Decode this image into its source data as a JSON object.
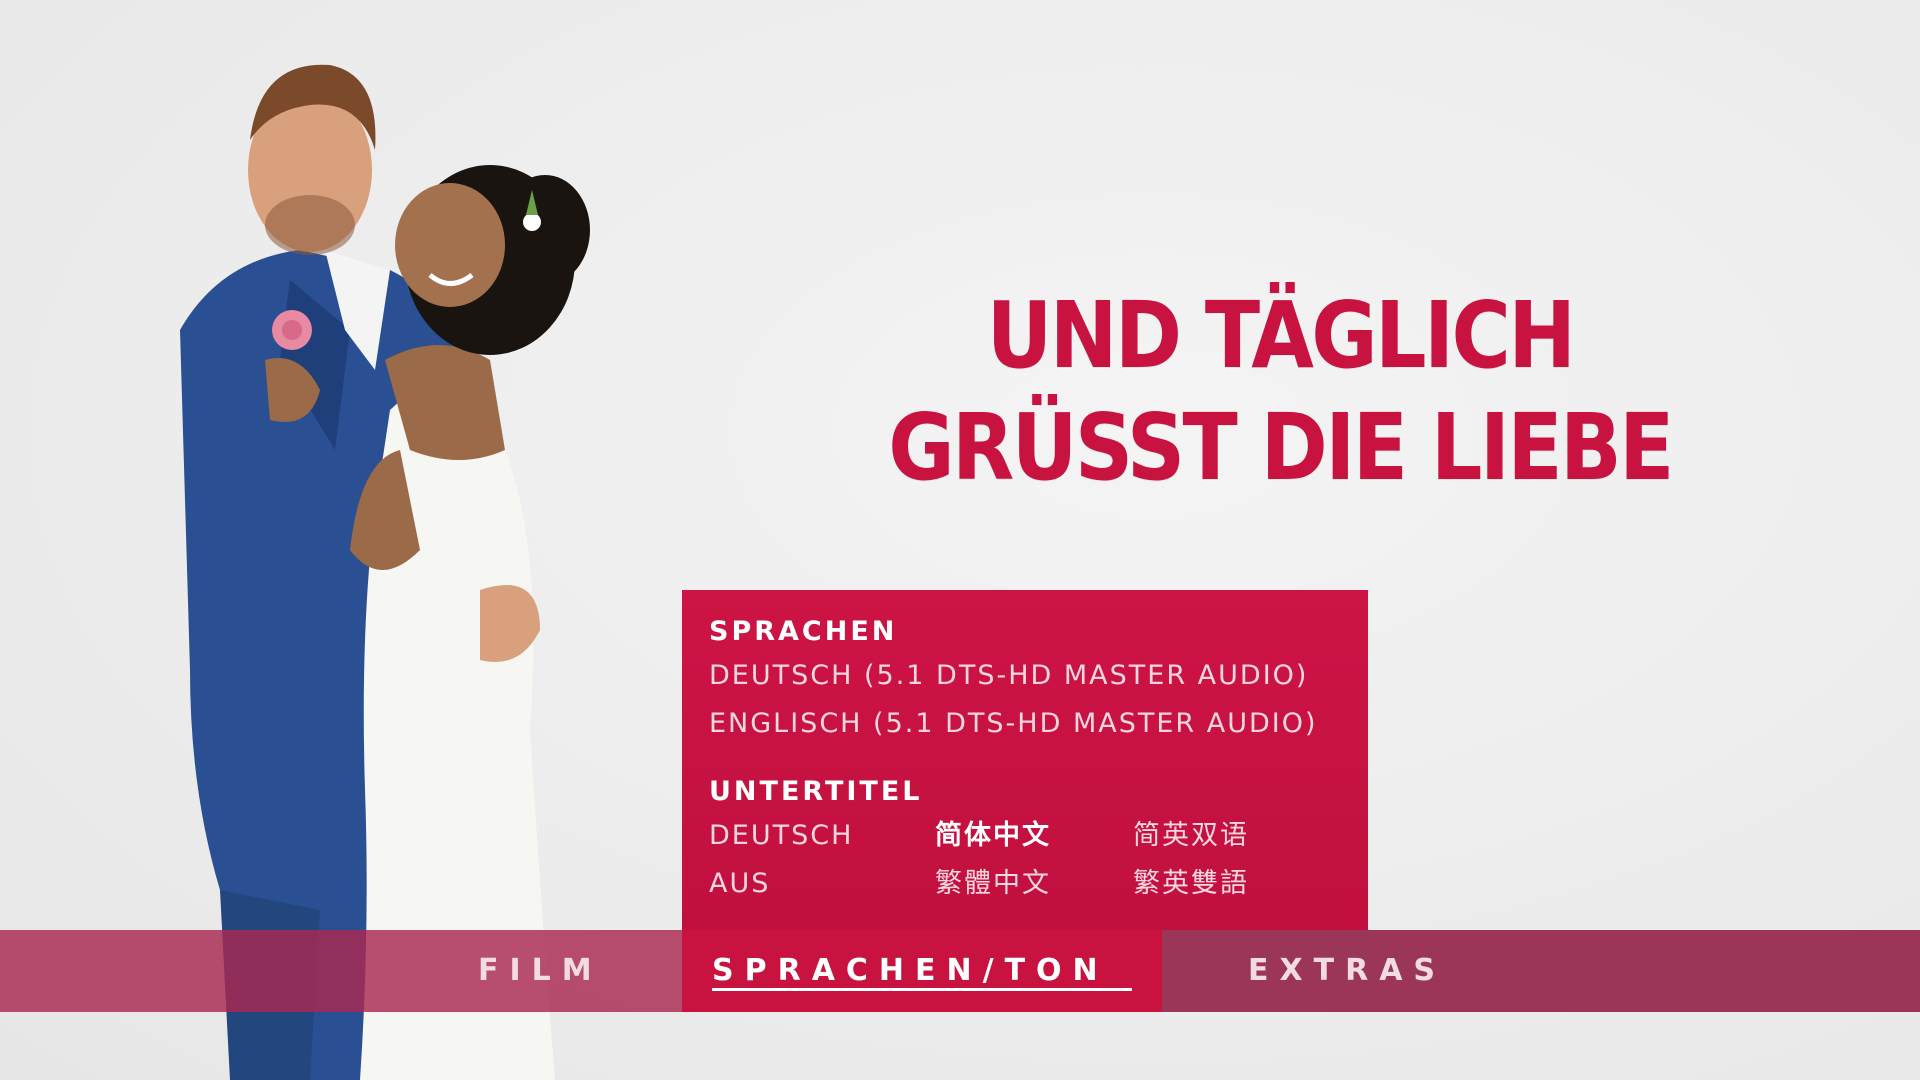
{
  "movie": {
    "title_line1": "UND TÄGLICH",
    "title_line2": "GRÜSST DIE LIEBE"
  },
  "menu": {
    "languages_header": "SPRACHEN",
    "audio_options": [
      "DEUTSCH (5.1 DTS-HD MASTER AUDIO)",
      "ENGLISCH (5.1 DTS-HD MASTER AUDIO)"
    ],
    "subtitles_header": "UNTERTITEL",
    "subtitle_options": {
      "deutsch": "DEUTSCH",
      "aus": "AUS",
      "simplified_chinese": "简体中文",
      "traditional_chinese": "繁體中文",
      "simplified_bilingual": "简英双语",
      "traditional_bilingual": "繁英雙語"
    },
    "selected_subtitle": "简体中文"
  },
  "navigation": {
    "film": "FILM",
    "languages_sound": "SPRACHEN/TON",
    "extras": "EXTRAS",
    "active": "SPRACHEN/TON"
  },
  "colors": {
    "accent": "#c8123f",
    "nav_bar": "#aa2850",
    "background": "#eeeeee"
  }
}
